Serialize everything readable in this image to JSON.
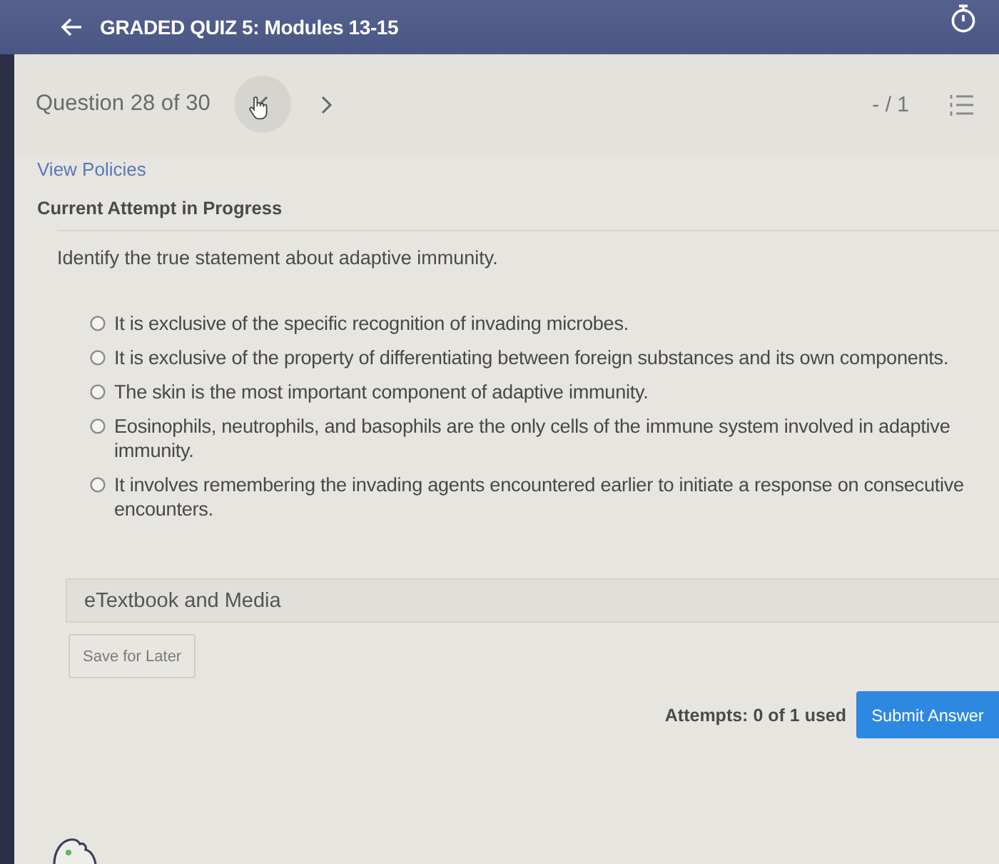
{
  "header": {
    "title": "GRADED QUIZ 5: Modules 13-15"
  },
  "question_nav": {
    "label": "Question 28 of 30",
    "score": "- / 1"
  },
  "view_policies": "View Policies",
  "attempt_status": "Current Attempt in Progress",
  "question": {
    "prompt": "Identify the true statement about adaptive immunity.",
    "options": [
      {
        "text": "It is exclusive of the specific recognition of invading microbes.",
        "selected": false
      },
      {
        "text": "It is exclusive of the property of differentiating between foreign substances and its own components.",
        "selected": false
      },
      {
        "text": "The skin is the most important component of adaptive immunity.",
        "selected": false
      },
      {
        "text": "Eosinophils, neutrophils, and basophils are the only cells of the immune system involved in adaptive immunity.",
        "selected": false
      },
      {
        "text": "It involves remembering the invading agents encountered earlier to initiate a response on consecutive encounters.",
        "selected": false
      }
    ]
  },
  "resources": {
    "label": "eTextbook and Media"
  },
  "save_button": "Save for Later",
  "attempts": "Attempts: 0 of 1 used",
  "submit_button": "Submit Answer"
}
